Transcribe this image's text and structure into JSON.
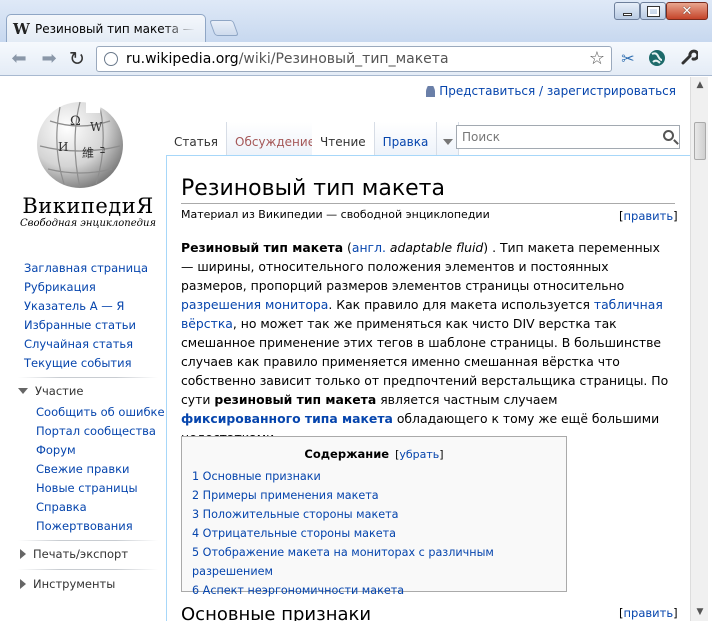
{
  "browser": {
    "tab_title": "Резиновый тип макета — В",
    "tab_favicon": "W",
    "url_host": "ru.wikipedia.org",
    "url_path": "/wiki/Резиновый_тип_макета",
    "icons": [
      "back-arrow-icon",
      "forward-arrow-icon",
      "reload-icon",
      "page-icon",
      "star-icon",
      "scissors-icon",
      "globe-icon",
      "wrench-icon"
    ]
  },
  "personal": {
    "login_label": "Представиться / зарегистрироваться"
  },
  "logo": {
    "wordmark": "ВикипедиЯ",
    "tagline": "Свободная энциклопедия"
  },
  "navigation": [
    "Заглавная страница",
    "Рубрикация",
    "Указатель А — Я",
    "Избранные статьи",
    "Случайная статья",
    "Текущие события"
  ],
  "participation": {
    "heading": "Участие",
    "items": [
      "Сообщить об ошибке",
      "Портал сообщества",
      "Форум",
      "Свежие правки",
      "Новые страницы",
      "Справка",
      "Пожертвования"
    ]
  },
  "print_export": {
    "heading": "Печать/экспорт"
  },
  "tools": {
    "heading": "Инструменты"
  },
  "tabs": {
    "article": "Статья",
    "talk": "Обсуждение",
    "read": "Чтение",
    "edit": "Правка"
  },
  "search": {
    "placeholder": "Поиск"
  },
  "article": {
    "title": "Резиновый тип макета",
    "site_sub": "Материал из Википедии — свободной энциклопедии",
    "edit_link": "править",
    "p_title_bold": "Резиновый тип макета",
    "p_lang": "англ.",
    "p_term": "adaptable fluid",
    "p_text1": ". Тип макета переменных — ширины, относительного положения элементов и постоянных размеров, пропорций размеров элементов страницы относительно",
    "p_link1": "разрешения монитора",
    "p_text2": ". Как правило для макета используется",
    "p_link2": "табличная вёрстка",
    "p_text3": ", но может так же применяться как чисто DIV верстка так смешанное применение этих тегов в шаблоне страницы. В большинстве случаев как правило применяется именно смешанная вёрстка что собственно зависит только от предпочтений верстальщика страницы. По сути",
    "p_bold2": "резиновый тип макета",
    "p_text4": "является частным случаем",
    "p_link3": "фиксированного типа макета",
    "p_text5": "обладающего к тому же ещё большими недостатками.",
    "toc_title": "Содержание",
    "toc_hide": "убрать",
    "toc_items": [
      "1 Основные признаки",
      "2 Примеры применения макета",
      "3 Положительные стороны макета",
      "4 Отрицательные стороны макета",
      "5 Отображение макета на мониторах с различным разрешением",
      "6 Аспект неэргономичности макета"
    ],
    "section1_title": "Основные признаки"
  }
}
